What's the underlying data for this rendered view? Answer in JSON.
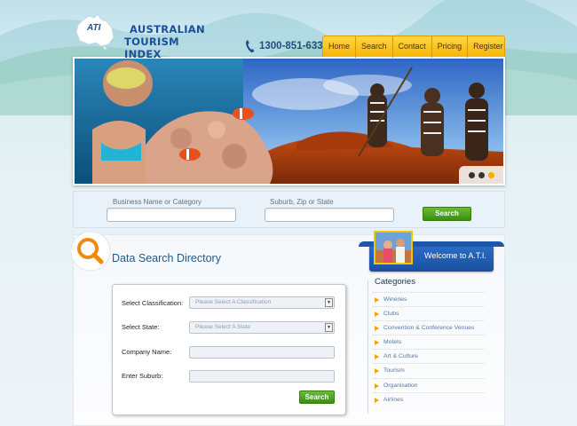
{
  "logo": {
    "abbr": "ATI",
    "line1": "AUSTRALIAN",
    "line2": "TOURISM  INDEX"
  },
  "header": {
    "phone": "1300-851-633",
    "nav": [
      "Home",
      "Search",
      "Contact",
      "Pricing",
      "Register"
    ]
  },
  "slider": {
    "dots": 3,
    "active_dot": 2
  },
  "search_bar": {
    "business_label": "Business Name or Category",
    "business_value": "",
    "location_label": "Suburb, Zip or State",
    "location_value": "",
    "button": "Search"
  },
  "directory": {
    "title": "Data Search Directory",
    "classification_label": "Select Classification:",
    "classification_value": "Please Select A Classification",
    "state_label": "Select State:",
    "state_value": "Please Select A State",
    "company_label": "Company Name:",
    "company_value": "",
    "suburb_label": "Enter Suburb:",
    "suburb_value": "",
    "button": "Search"
  },
  "sidebar": {
    "welcome": "Welcome to A.T.I.",
    "categories_title": "Categories",
    "categories": [
      "Wineries",
      "Clubs",
      "Convention & Conference Venues",
      "Motels",
      "Art & Culture",
      "Tourism",
      "Organisation",
      "Airlines"
    ]
  },
  "colors": {
    "nav_yellow": "#f5b507",
    "brand_blue": "#1a4f9a",
    "button_green": "#4fa321",
    "bullet_orange": "#f0a400"
  }
}
